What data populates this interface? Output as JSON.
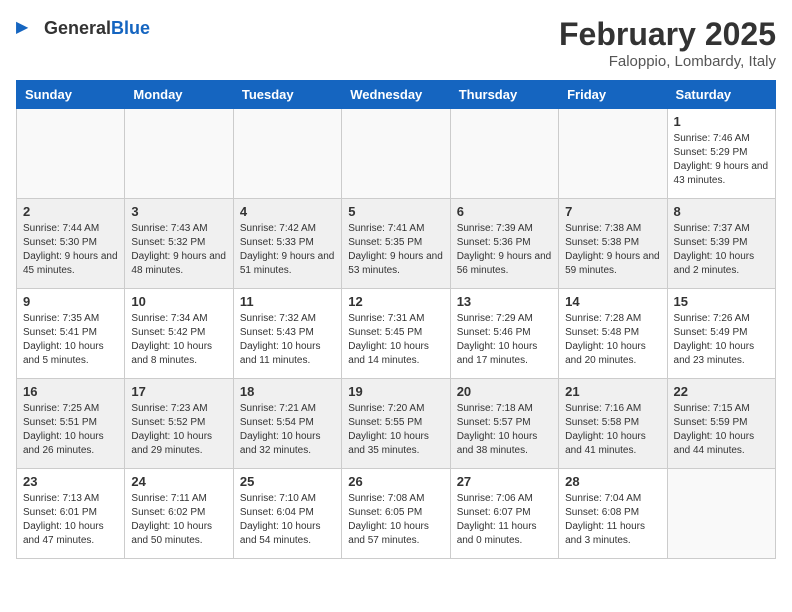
{
  "header": {
    "logo_general": "General",
    "logo_blue": "Blue",
    "month": "February 2025",
    "location": "Faloppio, Lombardy, Italy"
  },
  "weekdays": [
    "Sunday",
    "Monday",
    "Tuesday",
    "Wednesday",
    "Thursday",
    "Friday",
    "Saturday"
  ],
  "weeks": [
    {
      "shaded": false,
      "days": [
        {
          "date": "",
          "info": ""
        },
        {
          "date": "",
          "info": ""
        },
        {
          "date": "",
          "info": ""
        },
        {
          "date": "",
          "info": ""
        },
        {
          "date": "",
          "info": ""
        },
        {
          "date": "",
          "info": ""
        },
        {
          "date": "1",
          "info": "Sunrise: 7:46 AM\nSunset: 5:29 PM\nDaylight: 9 hours and 43 minutes."
        }
      ]
    },
    {
      "shaded": true,
      "days": [
        {
          "date": "2",
          "info": "Sunrise: 7:44 AM\nSunset: 5:30 PM\nDaylight: 9 hours and 45 minutes."
        },
        {
          "date": "3",
          "info": "Sunrise: 7:43 AM\nSunset: 5:32 PM\nDaylight: 9 hours and 48 minutes."
        },
        {
          "date": "4",
          "info": "Sunrise: 7:42 AM\nSunset: 5:33 PM\nDaylight: 9 hours and 51 minutes."
        },
        {
          "date": "5",
          "info": "Sunrise: 7:41 AM\nSunset: 5:35 PM\nDaylight: 9 hours and 53 minutes."
        },
        {
          "date": "6",
          "info": "Sunrise: 7:39 AM\nSunset: 5:36 PM\nDaylight: 9 hours and 56 minutes."
        },
        {
          "date": "7",
          "info": "Sunrise: 7:38 AM\nSunset: 5:38 PM\nDaylight: 9 hours and 59 minutes."
        },
        {
          "date": "8",
          "info": "Sunrise: 7:37 AM\nSunset: 5:39 PM\nDaylight: 10 hours and 2 minutes."
        }
      ]
    },
    {
      "shaded": false,
      "days": [
        {
          "date": "9",
          "info": "Sunrise: 7:35 AM\nSunset: 5:41 PM\nDaylight: 10 hours and 5 minutes."
        },
        {
          "date": "10",
          "info": "Sunrise: 7:34 AM\nSunset: 5:42 PM\nDaylight: 10 hours and 8 minutes."
        },
        {
          "date": "11",
          "info": "Sunrise: 7:32 AM\nSunset: 5:43 PM\nDaylight: 10 hours and 11 minutes."
        },
        {
          "date": "12",
          "info": "Sunrise: 7:31 AM\nSunset: 5:45 PM\nDaylight: 10 hours and 14 minutes."
        },
        {
          "date": "13",
          "info": "Sunrise: 7:29 AM\nSunset: 5:46 PM\nDaylight: 10 hours and 17 minutes."
        },
        {
          "date": "14",
          "info": "Sunrise: 7:28 AM\nSunset: 5:48 PM\nDaylight: 10 hours and 20 minutes."
        },
        {
          "date": "15",
          "info": "Sunrise: 7:26 AM\nSunset: 5:49 PM\nDaylight: 10 hours and 23 minutes."
        }
      ]
    },
    {
      "shaded": true,
      "days": [
        {
          "date": "16",
          "info": "Sunrise: 7:25 AM\nSunset: 5:51 PM\nDaylight: 10 hours and 26 minutes."
        },
        {
          "date": "17",
          "info": "Sunrise: 7:23 AM\nSunset: 5:52 PM\nDaylight: 10 hours and 29 minutes."
        },
        {
          "date": "18",
          "info": "Sunrise: 7:21 AM\nSunset: 5:54 PM\nDaylight: 10 hours and 32 minutes."
        },
        {
          "date": "19",
          "info": "Sunrise: 7:20 AM\nSunset: 5:55 PM\nDaylight: 10 hours and 35 minutes."
        },
        {
          "date": "20",
          "info": "Sunrise: 7:18 AM\nSunset: 5:57 PM\nDaylight: 10 hours and 38 minutes."
        },
        {
          "date": "21",
          "info": "Sunrise: 7:16 AM\nSunset: 5:58 PM\nDaylight: 10 hours and 41 minutes."
        },
        {
          "date": "22",
          "info": "Sunrise: 7:15 AM\nSunset: 5:59 PM\nDaylight: 10 hours and 44 minutes."
        }
      ]
    },
    {
      "shaded": false,
      "days": [
        {
          "date": "23",
          "info": "Sunrise: 7:13 AM\nSunset: 6:01 PM\nDaylight: 10 hours and 47 minutes."
        },
        {
          "date": "24",
          "info": "Sunrise: 7:11 AM\nSunset: 6:02 PM\nDaylight: 10 hours and 50 minutes."
        },
        {
          "date": "25",
          "info": "Sunrise: 7:10 AM\nSunset: 6:04 PM\nDaylight: 10 hours and 54 minutes."
        },
        {
          "date": "26",
          "info": "Sunrise: 7:08 AM\nSunset: 6:05 PM\nDaylight: 10 hours and 57 minutes."
        },
        {
          "date": "27",
          "info": "Sunrise: 7:06 AM\nSunset: 6:07 PM\nDaylight: 11 hours and 0 minutes."
        },
        {
          "date": "28",
          "info": "Sunrise: 7:04 AM\nSunset: 6:08 PM\nDaylight: 11 hours and 3 minutes."
        },
        {
          "date": "",
          "info": ""
        }
      ]
    }
  ]
}
